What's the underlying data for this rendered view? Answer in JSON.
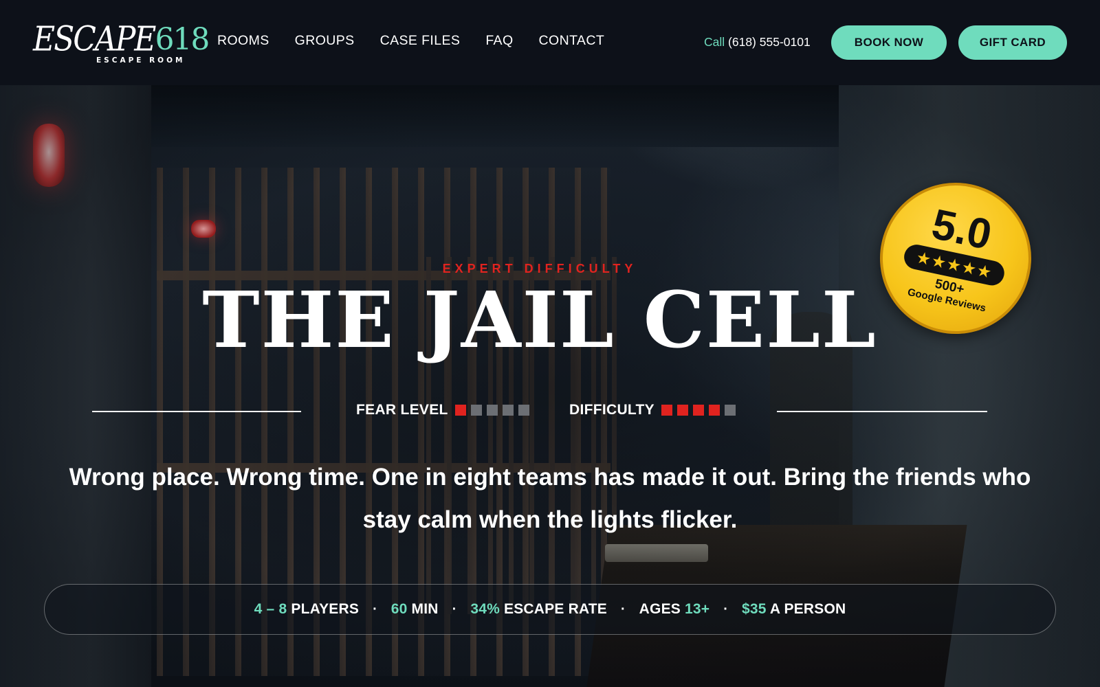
{
  "logo": {
    "word": "ESCAPE",
    "number": "618",
    "subtitle": "ESCAPE ROOM"
  },
  "nav": {
    "links": [
      "ROOMS",
      "GROUPS",
      "CASE FILES",
      "FAQ",
      "CONTACT"
    ],
    "call_label": "Call",
    "phone": "(618) 555-0101",
    "book_label": "BOOK NOW",
    "gift_label": "GIFT CARD"
  },
  "badge": {
    "score": "5.0",
    "stars": "★★★★★",
    "count": "500+",
    "label": "Google Reviews"
  },
  "hero": {
    "kicker": "EXPERT DIFFICULTY",
    "title": "THE JAIL CELL",
    "fear_label": "FEAR LEVEL",
    "fear_level": 1,
    "fear_max": 5,
    "difficulty_label": "DIFFICULTY",
    "difficulty_level": 4,
    "difficulty_max": 5,
    "tagline": "Wrong place. Wrong time. One in eight teams has made it out. Bring the friends who stay calm when the lights flicker."
  },
  "stats": {
    "players_value": "4 – 8",
    "players_label": " PLAYERS",
    "time_value": "60",
    "time_label": " MIN",
    "rate_value": "34%",
    "rate_label": " ESCAPE RATE",
    "ages_label": "AGES ",
    "ages_value": "13+",
    "price_value": "$35",
    "price_label": " A PERSON",
    "separator": "·"
  },
  "colors": {
    "accent": "#6fdcbd",
    "danger": "#e0231f",
    "navbar": "#0d1119",
    "badge": "#f7c51a"
  }
}
